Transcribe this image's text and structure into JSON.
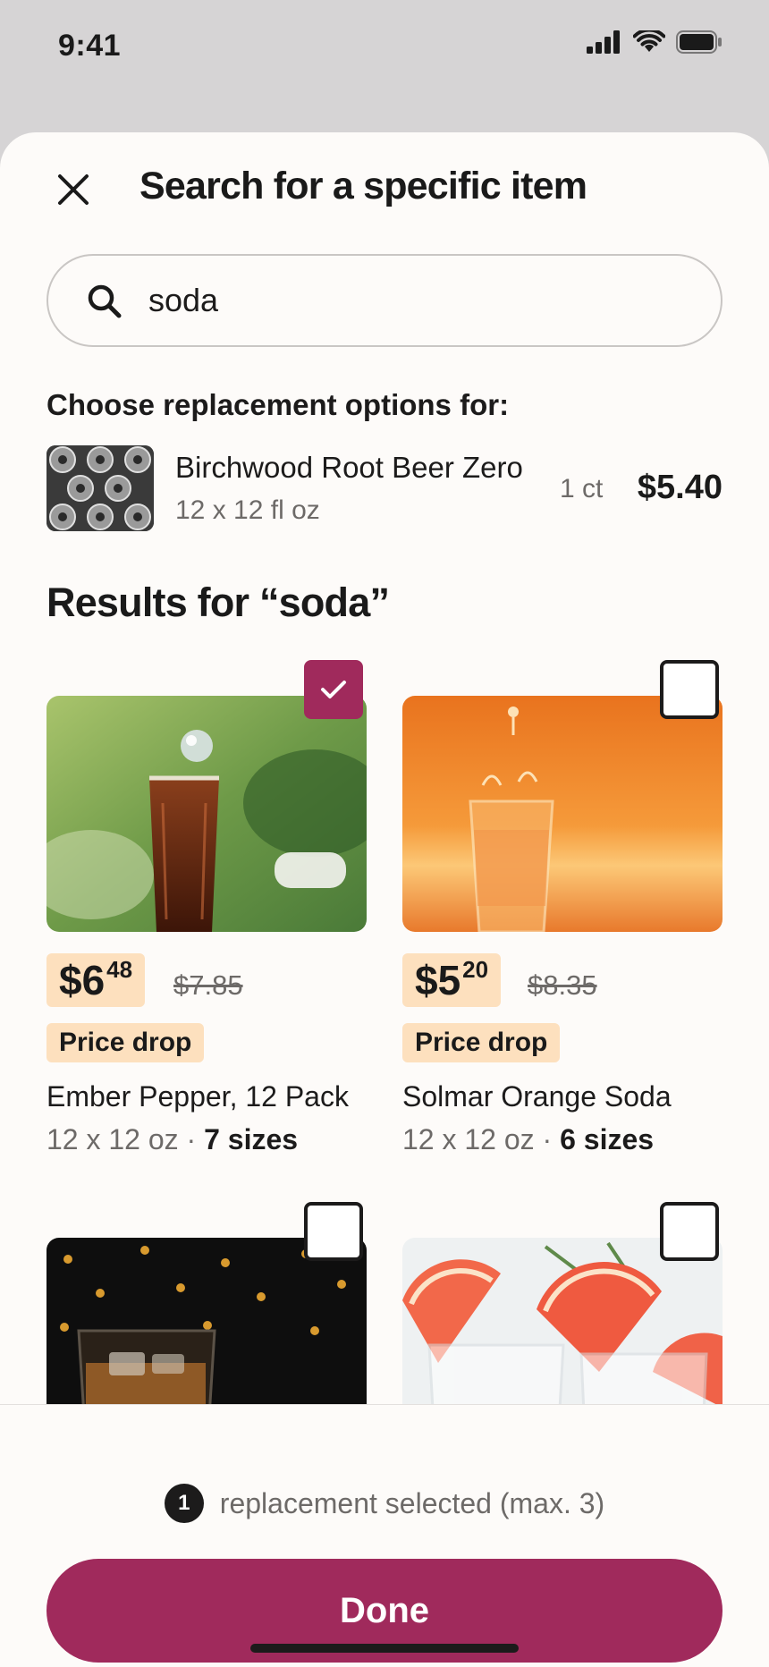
{
  "status_bar": {
    "time": "9:41"
  },
  "sheet": {
    "title": "Search for a specific item"
  },
  "search": {
    "value": "soda",
    "placeholder": ""
  },
  "original": {
    "label": "Choose replacement options for:",
    "name": "Birchwood Root Beer Zero",
    "size": "12 x 12 fl oz",
    "qty": "1 ct",
    "price": "$5.40"
  },
  "results": {
    "heading": "Results for “soda”",
    "items": [
      {
        "price_dollars": "$6",
        "price_cents": "48",
        "old_price": "$7.85",
        "badge": "Price drop",
        "name": "Ember Pepper, 12 Pack",
        "size": "12 x 12 oz · ",
        "sizes": "7 sizes",
        "checked": true
      },
      {
        "price_dollars": "$5",
        "price_cents": "20",
        "old_price": "$8.35",
        "badge": "Price drop",
        "name": "Solmar Orange Soda",
        "size": "12 x 12 oz · ",
        "sizes": "6 sizes",
        "checked": false
      },
      {
        "checked": false
      },
      {
        "checked": false
      }
    ]
  },
  "footer": {
    "count": "1",
    "selection_text": "replacement selected (max. 3)",
    "done_label": "Done"
  },
  "colors": {
    "accent": "#a02a5c",
    "price_bg": "#fde0be",
    "sheet_bg": "#fdfbf9"
  }
}
